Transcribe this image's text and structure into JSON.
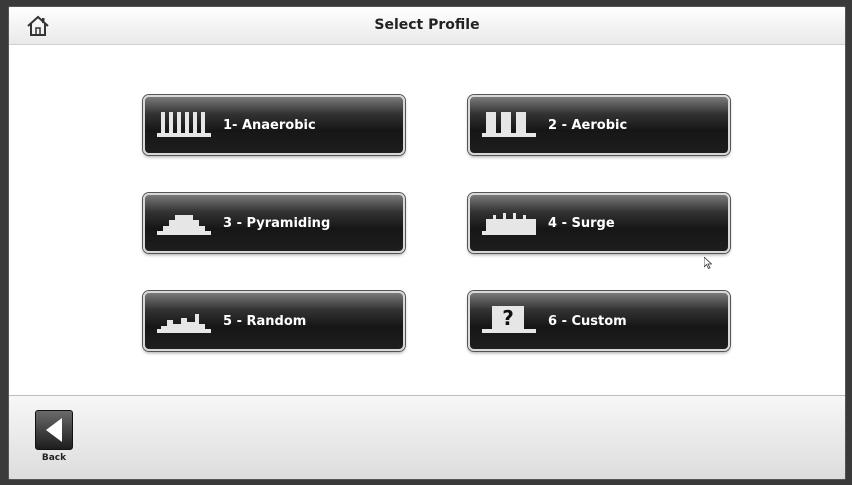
{
  "header": {
    "title": "Select Profile",
    "home_icon": "home-icon"
  },
  "profiles": [
    {
      "label": "1- Anaerobic",
      "icon": "anaerobic-profile-icon"
    },
    {
      "label": "2 - Aerobic",
      "icon": "aerobic-profile-icon"
    },
    {
      "label": "3 - Pyramiding",
      "icon": "pyramiding-profile-icon"
    },
    {
      "label": "4 - Surge",
      "icon": "surge-profile-icon"
    },
    {
      "label": "5 - Random",
      "icon": "random-profile-icon"
    },
    {
      "label": "6 - Custom",
      "icon": "custom-profile-icon"
    }
  ],
  "footer": {
    "back_label": "Back",
    "back_icon": "back-arrow-icon"
  },
  "colors": {
    "button_dark": "#161616",
    "button_border": "#d8d8d8",
    "icon_fill": "#e6e6e6"
  }
}
